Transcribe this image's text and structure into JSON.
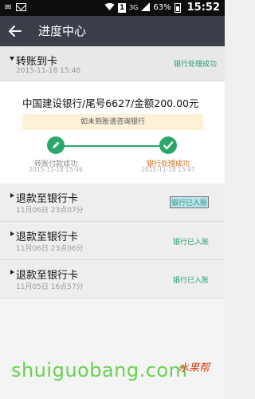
{
  "statusbar": {
    "signal_3g": "3G",
    "sim": "1",
    "battery": "63%",
    "time": "15:52"
  },
  "header": {
    "back_icon": "arrow-left-icon",
    "title": "进度中心"
  },
  "current": {
    "title": "转账到卡",
    "date": "2015-11-18 15:46",
    "status": "银行处理成功",
    "detail": "中国建设银行/尾号6627/金额200.00元",
    "notice": "如未到账请咨询银行",
    "steps": [
      {
        "label": "转账付款成功",
        "time": "2015-11-18 15:46"
      },
      {
        "label": "银行处理成功",
        "time": "2015-11-18 15:47"
      }
    ]
  },
  "history": [
    {
      "title": "退款至银行卡",
      "date": "11月06日 23点07分",
      "status": "银行已入账"
    },
    {
      "title": "退款至银行卡",
      "date": "11月06日 23点06分",
      "status": "银行已入账"
    },
    {
      "title": "退款至银行卡",
      "date": "11月05日 16点57分",
      "status": "银行已入账"
    }
  ],
  "watermark": {
    "text": "shuiguobang.com",
    "cn": "水果帮"
  },
  "colors": {
    "header_bg": "#3b3f4a",
    "success_green": "#27a06b",
    "highlight_orange": "#e06c1a"
  }
}
